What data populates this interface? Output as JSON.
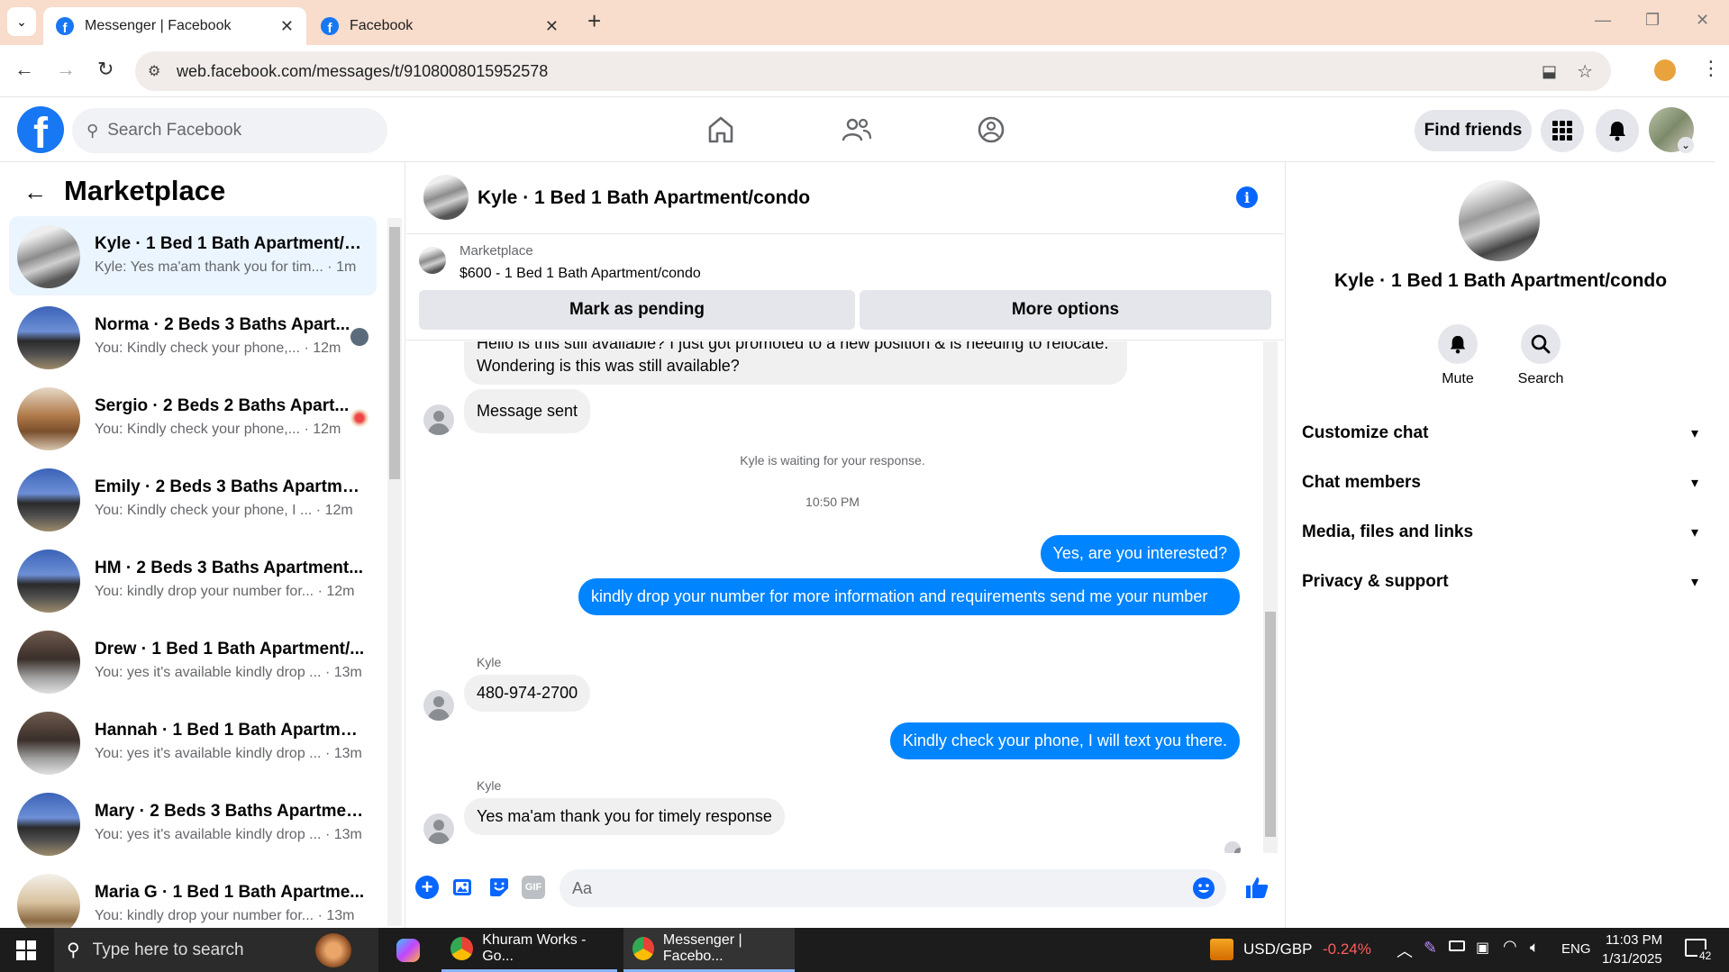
{
  "browser": {
    "tabs": [
      {
        "title": "Messenger | Facebook"
      },
      {
        "title": "Facebook"
      }
    ],
    "new_tab": "+",
    "url": "web.facebook.com/messages/t/9108008015952578"
  },
  "facebook": {
    "search_placeholder": "Search Facebook",
    "find_friends": "Find friends"
  },
  "left": {
    "title": "Marketplace",
    "conversations": [
      {
        "name": "Kyle · 1 Bed 1 Bath Apartment/c...",
        "preview": "Kyle: Yes ma'am thank you for tim...",
        "time": "· 1m"
      },
      {
        "name": "Norma · 2 Beds 3 Baths Apart...",
        "preview": "You: Kindly check your phone,...",
        "time": "· 12m"
      },
      {
        "name": "Sergio · 2 Beds 2 Baths Apart...",
        "preview": "You: Kindly check your phone,...",
        "time": "· 12m"
      },
      {
        "name": "Emily · 2 Beds 3 Baths Apartme...",
        "preview": "You: Kindly check your phone, I ...",
        "time": "· 12m"
      },
      {
        "name": "HM · 2 Beds 3 Baths Apartment...",
        "preview": "You: kindly drop your number for...",
        "time": "· 12m"
      },
      {
        "name": "Drew · 1 Bed 1 Bath Apartment/...",
        "preview": "You: yes it's available kindly drop ...",
        "time": "· 13m"
      },
      {
        "name": "Hannah · 1 Bed 1 Bath Apartmen...",
        "preview": "You: yes it's available kindly drop ...",
        "time": "· 13m"
      },
      {
        "name": "Mary · 2 Beds 3 Baths Apartmen...",
        "preview": "You: yes it's available kindly drop ...",
        "time": "· 13m"
      },
      {
        "name": "Maria G · 1 Bed 1 Bath Apartme...",
        "preview": "You: kindly drop your number for...",
        "time": "· 13m"
      }
    ]
  },
  "chat": {
    "header_title": "Kyle · 1 Bed 1 Bath Apartment/condo",
    "listing_source": "Marketplace",
    "listing_title": "$600 - 1 Bed 1 Bath Apartment/condo",
    "mark_pending": "Mark as pending",
    "more_options": "More options",
    "msg_partial": "Hello is this still available? I just got promoted to a new position & is needing to relocate. Wondering is this was still available?",
    "msg_sent": "Message sent",
    "waiting": "Kyle is waiting for your response.",
    "time_sep": "10:50 PM",
    "out1": "Yes, are you interested?",
    "out2": "kindly drop your number for more information and requirements send me your number",
    "sender1": "Kyle",
    "in1": "480-974-2700",
    "out3": "Kindly check your phone, I will text you there.",
    "sender2": "Kyle",
    "in2": "Yes ma'am thank you for timely response",
    "composer_placeholder": "Aa"
  },
  "right": {
    "name": "Kyle · 1 Bed 1 Bath Apartment/condo",
    "mute": "Mute",
    "search": "Search",
    "sections": [
      "Customize chat",
      "Chat members",
      "Media, files and links",
      "Privacy & support"
    ]
  },
  "taskbar": {
    "search_placeholder": "Type here to search",
    "app1": "Khuram Works - Go...",
    "app2": "Messenger | Facebo...",
    "ticker": "USD/GBP",
    "ticker_change": "-0.24%",
    "lang": "ENG",
    "time": "11:03 PM",
    "date": "1/31/2025",
    "notif_count": "42"
  }
}
